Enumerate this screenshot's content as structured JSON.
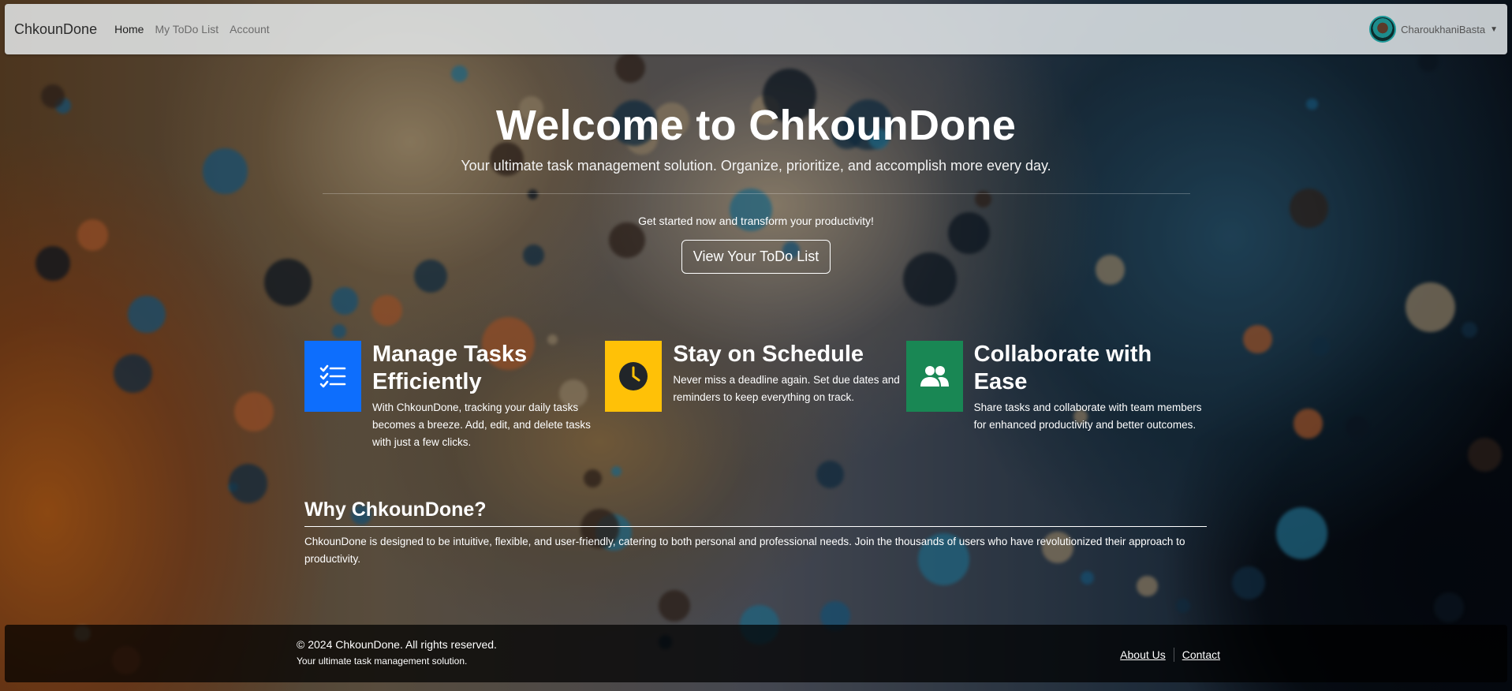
{
  "navbar": {
    "brand": "ChkounDone",
    "links": [
      {
        "label": "Home",
        "active": true
      },
      {
        "label": "My ToDo List",
        "active": false
      },
      {
        "label": "Account",
        "active": false
      }
    ],
    "user": {
      "name": "CharoukhaniBasta",
      "avatar_icon": "avatar-icon",
      "dropdown_icon": "caret-down-icon"
    }
  },
  "hero": {
    "title": "Welcome to ChkounDone",
    "subtitle": "Your ultimate task management solution. Organize, prioritize, and accomplish more every day.",
    "cta_text": "Get started now and transform your productivity!",
    "cta_button": "View Your ToDo List"
  },
  "features": [
    {
      "icon": "task-list-icon",
      "color": "#0d6efd",
      "title": "Manage Tasks Efficiently",
      "text": "With ChkounDone, tracking your daily tasks becomes a breeze. Add, edit, and delete tasks with just a few clicks."
    },
    {
      "icon": "clock-icon",
      "color": "#ffc107",
      "title": "Stay on Schedule",
      "text": "Never miss a deadline again. Set due dates and reminders to keep everything on track."
    },
    {
      "icon": "people-icon",
      "color": "#198754",
      "title": "Collaborate with Ease",
      "text": "Share tasks and collaborate with team members for enhanced productivity and better outcomes."
    }
  ],
  "why": {
    "title": "Why ChkounDone?",
    "text": "ChkounDone is designed to be intuitive, flexible, and user-friendly, catering to both personal and professional needs. Join the thousands of users who have revolutionized their approach to productivity."
  },
  "footer": {
    "copyright": "© 2024 ChkounDone. All rights reserved.",
    "tagline": "Your ultimate task management solution.",
    "links": [
      "About Us",
      "Contact"
    ]
  }
}
